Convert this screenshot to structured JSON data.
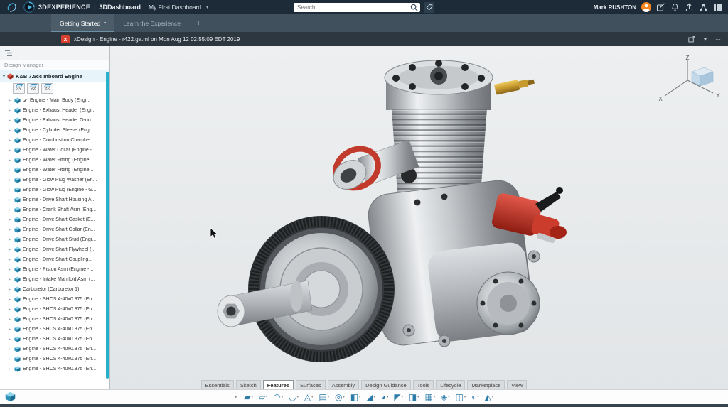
{
  "topbar": {
    "brand": "3DEXPERIENCE",
    "divider": "|",
    "app_name": "3DDashboard",
    "dashboard_name": "My First Dashboard",
    "search_placeholder": "Search",
    "user_name": "Mark RUSHTON"
  },
  "tabbar": {
    "add_label": "+",
    "tabs": [
      {
        "name": "dashboard-tab-getting-started",
        "label": "Getting Started",
        "active": true
      },
      {
        "name": "dashboard-tab-learn-the-experience",
        "label": "Learn the Experience"
      }
    ]
  },
  "appheader": {
    "title": "xDesign - Engine - r422.ga.ml on Mon Aug 12 02:55:09 EDT 2019"
  },
  "panel": {
    "header": "Design Manager",
    "root_label": "K&B 7.5cc Inboard Engine",
    "planes": [
      {
        "name": "plane-xy-button",
        "label": "XY"
      },
      {
        "name": "plane-yz-button",
        "label": "YZ"
      },
      {
        "name": "plane-zx-button",
        "label": "ZX"
      }
    ],
    "items": [
      {
        "label": "Engine - Main Body (Engi...",
        "cls": "edited"
      },
      {
        "label": "Engine - Exhaust Header (Engi..."
      },
      {
        "label": "Engine - Exhaust Header O-rin..."
      },
      {
        "label": "Engine - Cylinder Sleeve (Engi..."
      },
      {
        "label": "Engine - Combustion Chamber..."
      },
      {
        "label": "Engine - Water Collar (Engine -..."
      },
      {
        "label": "Engine - Water Fitting (Engine..."
      },
      {
        "label": "Engine - Water Fitting (Engine..."
      },
      {
        "label": "Engine - Glow Plug Washer (En..."
      },
      {
        "label": "Engine - Glow Plug (Engine - G..."
      },
      {
        "label": "Engine - Drive Shaft Housing A..."
      },
      {
        "label": "Engine - Crank Shaft Asm (Eng..."
      },
      {
        "label": "Engine - Drive Shaft Gasket (E..."
      },
      {
        "label": "Engine - Drive Shaft Collar (En..."
      },
      {
        "label": "Engine - Drive Shaft Stud (Engi..."
      },
      {
        "label": "Engine - Drive Shaft Flywheel (..."
      },
      {
        "label": "Engine - Drive Shaft Coupling..."
      },
      {
        "label": "Engine - Piston Asm (Engine -..."
      },
      {
        "label": "Engine - Intake Manifold Asm (..."
      },
      {
        "label": "Carburetor (Carburetor 1)"
      },
      {
        "label": "Engine - SHCS 4-40x0.375 (En..."
      },
      {
        "label": "Engine - SHCS 4-40x0.375 (En..."
      },
      {
        "label": "Engine - SHCS 4-40x0.375 (En..."
      },
      {
        "label": "Engine - SHCS 4-40x0.375 (En..."
      },
      {
        "label": "Engine - SHCS 4-40x0.375 (En..."
      },
      {
        "label": "Engine - SHCS 4-40x0.375 (En..."
      },
      {
        "label": "Engine - SHCS 4-40x0.375 (En..."
      },
      {
        "label": "Engine - SHCS 4-40x0.375 (En..."
      }
    ]
  },
  "viewport": {
    "axis_z": "Z",
    "axis_x": "X",
    "axis_y": "Y"
  },
  "ribbon": {
    "tabs": [
      {
        "name": "ribbon-tab-essentials",
        "label": "Essentials"
      },
      {
        "name": "ribbon-tab-sketch",
        "label": "Sketch"
      },
      {
        "name": "ribbon-tab-features",
        "label": "Features",
        "active": true
      },
      {
        "name": "ribbon-tab-surfaces",
        "label": "Surfaces"
      },
      {
        "name": "ribbon-tab-assembly",
        "label": "Assembly"
      },
      {
        "name": "ribbon-tab-design-guidance",
        "label": "Design Guidance"
      },
      {
        "name": "ribbon-tab-tools",
        "label": "Tools"
      },
      {
        "name": "ribbon-tab-lifecycle",
        "label": "Lifecycle"
      },
      {
        "name": "ribbon-tab-marketplace",
        "label": "Marketplace"
      },
      {
        "name": "ribbon-tab-view",
        "label": "View"
      }
    ]
  },
  "toolbar": {
    "tools": [
      {
        "name": "pad-tool-icon",
        "glyph": "▰"
      },
      {
        "name": "pocket-tool-icon",
        "glyph": "▱"
      },
      {
        "name": "revolve-tool-icon",
        "glyph": "◠"
      },
      {
        "name": "sweep-tool-icon",
        "glyph": "◡"
      },
      {
        "name": "loft-tool-icon",
        "glyph": "◬"
      },
      {
        "name": "rib-tool-icon",
        "glyph": "▤"
      },
      {
        "name": "hole-tool-icon",
        "glyph": "◎"
      },
      {
        "name": "shell-tool-icon",
        "glyph": "◧"
      },
      {
        "name": "draft-tool-icon",
        "glyph": "◢"
      },
      {
        "name": "fillet-tool-icon",
        "glyph": "◕"
      },
      {
        "name": "chamfer-tool-icon",
        "glyph": "◤"
      },
      {
        "name": "mirror-tool-icon",
        "glyph": "◨"
      },
      {
        "name": "pattern-tool-icon",
        "glyph": "▦"
      },
      {
        "name": "scale-tool-icon",
        "glyph": "◈"
      },
      {
        "name": "split-tool-icon",
        "glyph": "◫"
      },
      {
        "name": "boolean-tool-icon",
        "glyph": "◐"
      },
      {
        "name": "measure-tool-icon",
        "glyph": "◭"
      }
    ]
  },
  "colors": {
    "topbar_bg": "#1d2b38",
    "accent_teal": "#25b0cc",
    "tool_blue": "#2c7cab",
    "carb_red": "#c0392b",
    "brass": "#c79a2e",
    "avatar_orange": "#f6861f"
  }
}
